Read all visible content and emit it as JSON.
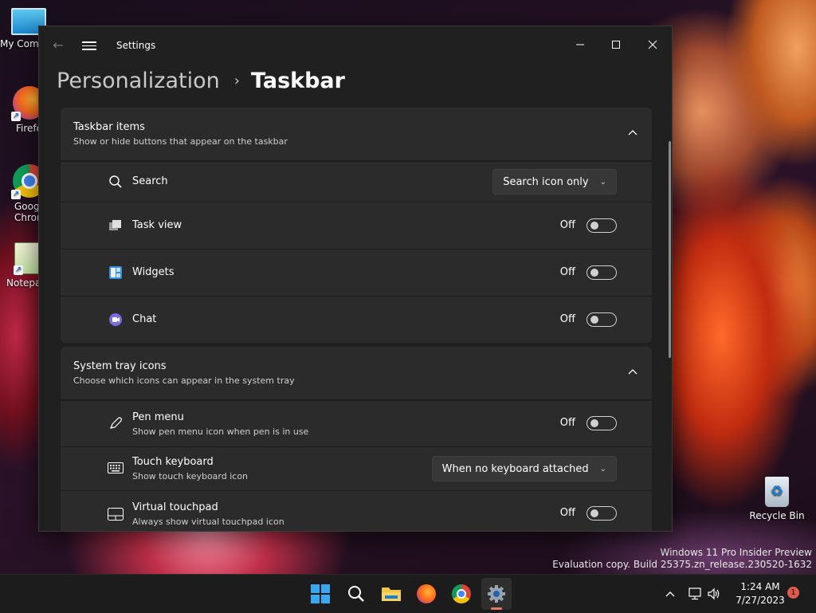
{
  "desktop": {
    "icons": [
      {
        "label": "My Com"
      },
      {
        "label": "Firefo"
      },
      {
        "label": "Goog\nChron"
      },
      {
        "label": "Notepa"
      },
      {
        "label": "Recycle Bin"
      }
    ],
    "watermark_line1": "Windows 11 Pro Insider Preview",
    "watermark_line2": "Evaluation copy. Build 25375.zn_release.230520-1632"
  },
  "window": {
    "title": "Settings",
    "breadcrumb_parent": "Personalization",
    "breadcrumb_current": "Taskbar"
  },
  "taskbar_items": {
    "title": "Taskbar items",
    "subtitle": "Show or hide buttons that appear on the taskbar",
    "rows": [
      {
        "label": "Search",
        "control": "dropdown",
        "value": "Search icon only"
      },
      {
        "label": "Task view",
        "control": "toggle",
        "state": "Off"
      },
      {
        "label": "Widgets",
        "control": "toggle",
        "state": "Off"
      },
      {
        "label": "Chat",
        "control": "toggle",
        "state": "Off"
      }
    ]
  },
  "system_tray": {
    "title": "System tray icons",
    "subtitle": "Choose which icons can appear in the system tray",
    "rows": [
      {
        "label": "Pen menu",
        "sub": "Show pen menu icon when pen is in use",
        "control": "toggle",
        "state": "Off"
      },
      {
        "label": "Touch keyboard",
        "sub": "Show touch keyboard icon",
        "control": "dropdown",
        "value": "When no keyboard attached"
      },
      {
        "label": "Virtual touchpad",
        "sub": "Always show virtual touchpad icon",
        "control": "toggle",
        "state": "Off"
      }
    ]
  },
  "tray": {
    "time": "1:24 AM",
    "date": "7/27/2023",
    "notifications": "1"
  },
  "colors": {
    "window_bg": "#202020",
    "card_bg": "#2b2b2b",
    "accent_indicator": "#e27a6a"
  }
}
